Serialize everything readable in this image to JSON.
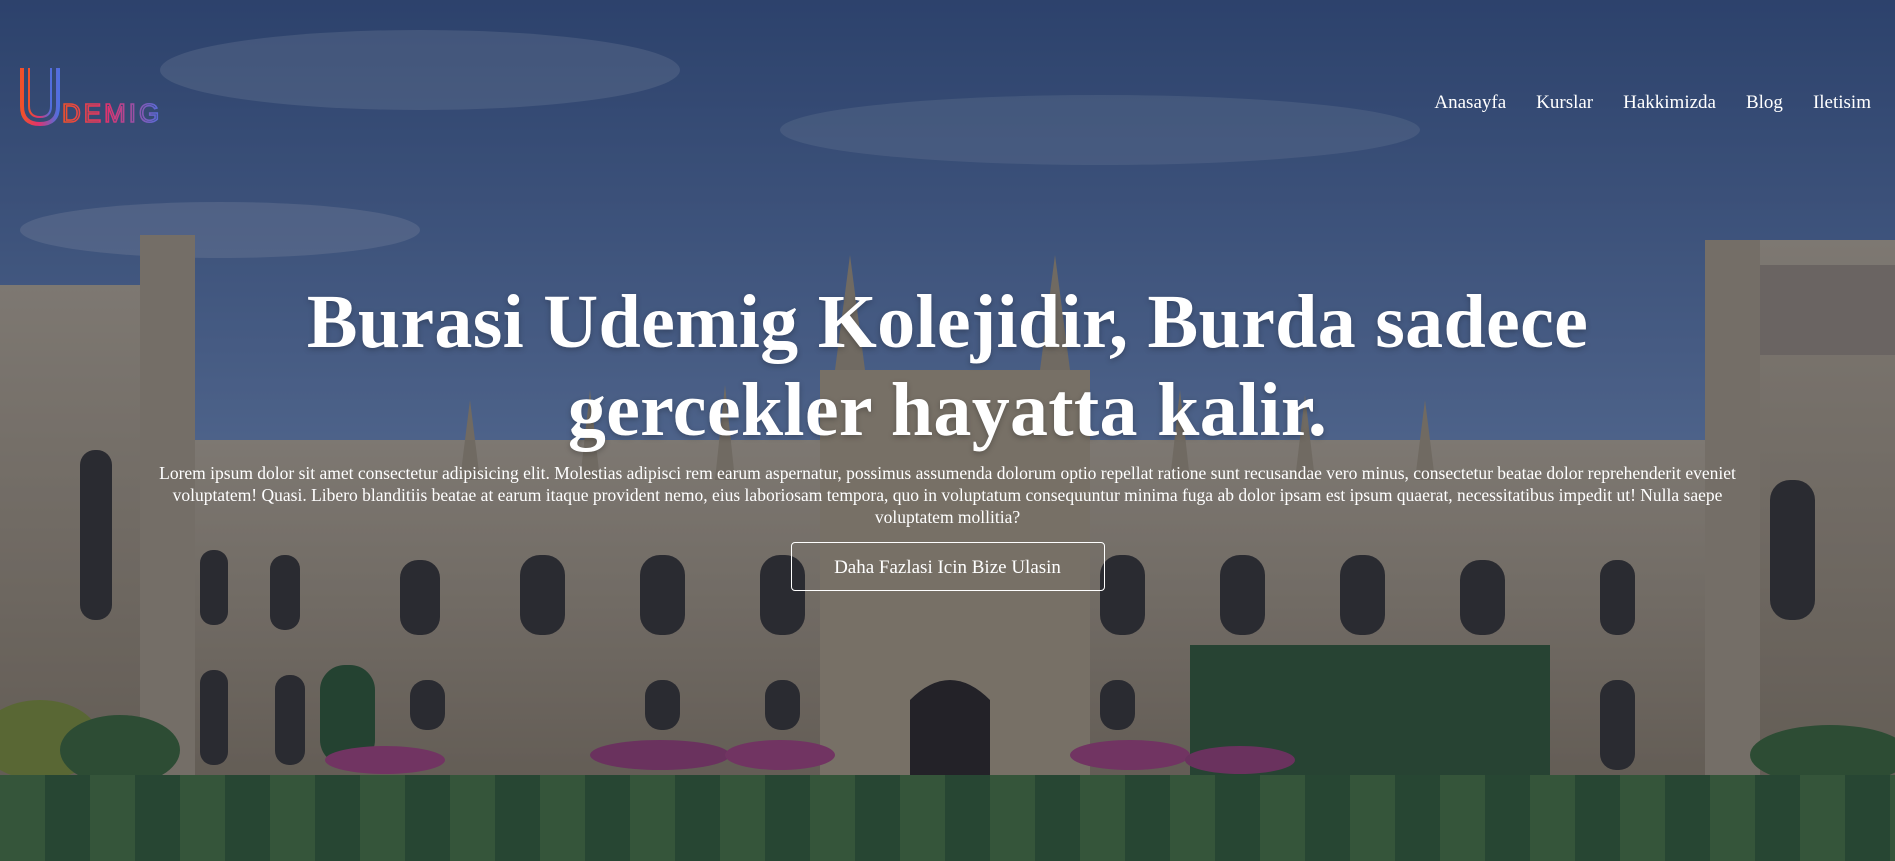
{
  "brand": {
    "logo_text": "UDEMIG",
    "logo_colors": [
      "#f0512a",
      "#e0336e",
      "#6b4fd8",
      "#3f6fe0"
    ]
  },
  "nav": {
    "items": [
      {
        "label": "Anasayfa"
      },
      {
        "label": "Kurslar"
      },
      {
        "label": "Hakkimizda"
      },
      {
        "label": "Blog"
      },
      {
        "label": "Iletisim"
      }
    ]
  },
  "hero": {
    "headline": "Burasi Udemig Kolejidir, Burda sadece gercekler hayatta kalir.",
    "description": "Lorem ipsum dolor sit amet consectetur adipisicing elit. Molestias adipisci rem earum aspernatur, possimus assumenda dolorum optio repellat ratione sunt recusandae vero minus, consectetur beatae dolor reprehenderit eveniet voluptatem! Quasi. Libero blanditiis beatae at earum itaque provident nemo, eius laboriosam tempora, quo in voluptatum consequuntur minima fuga ab dolor ipsam est ipsum quaerat, necessitatibus impedit ut! Nulla saepe voluptatem mollitia?",
    "cta_label": "Daha Fazlasi Icin Bize Ulasin",
    "background": "college-quad-photo"
  }
}
